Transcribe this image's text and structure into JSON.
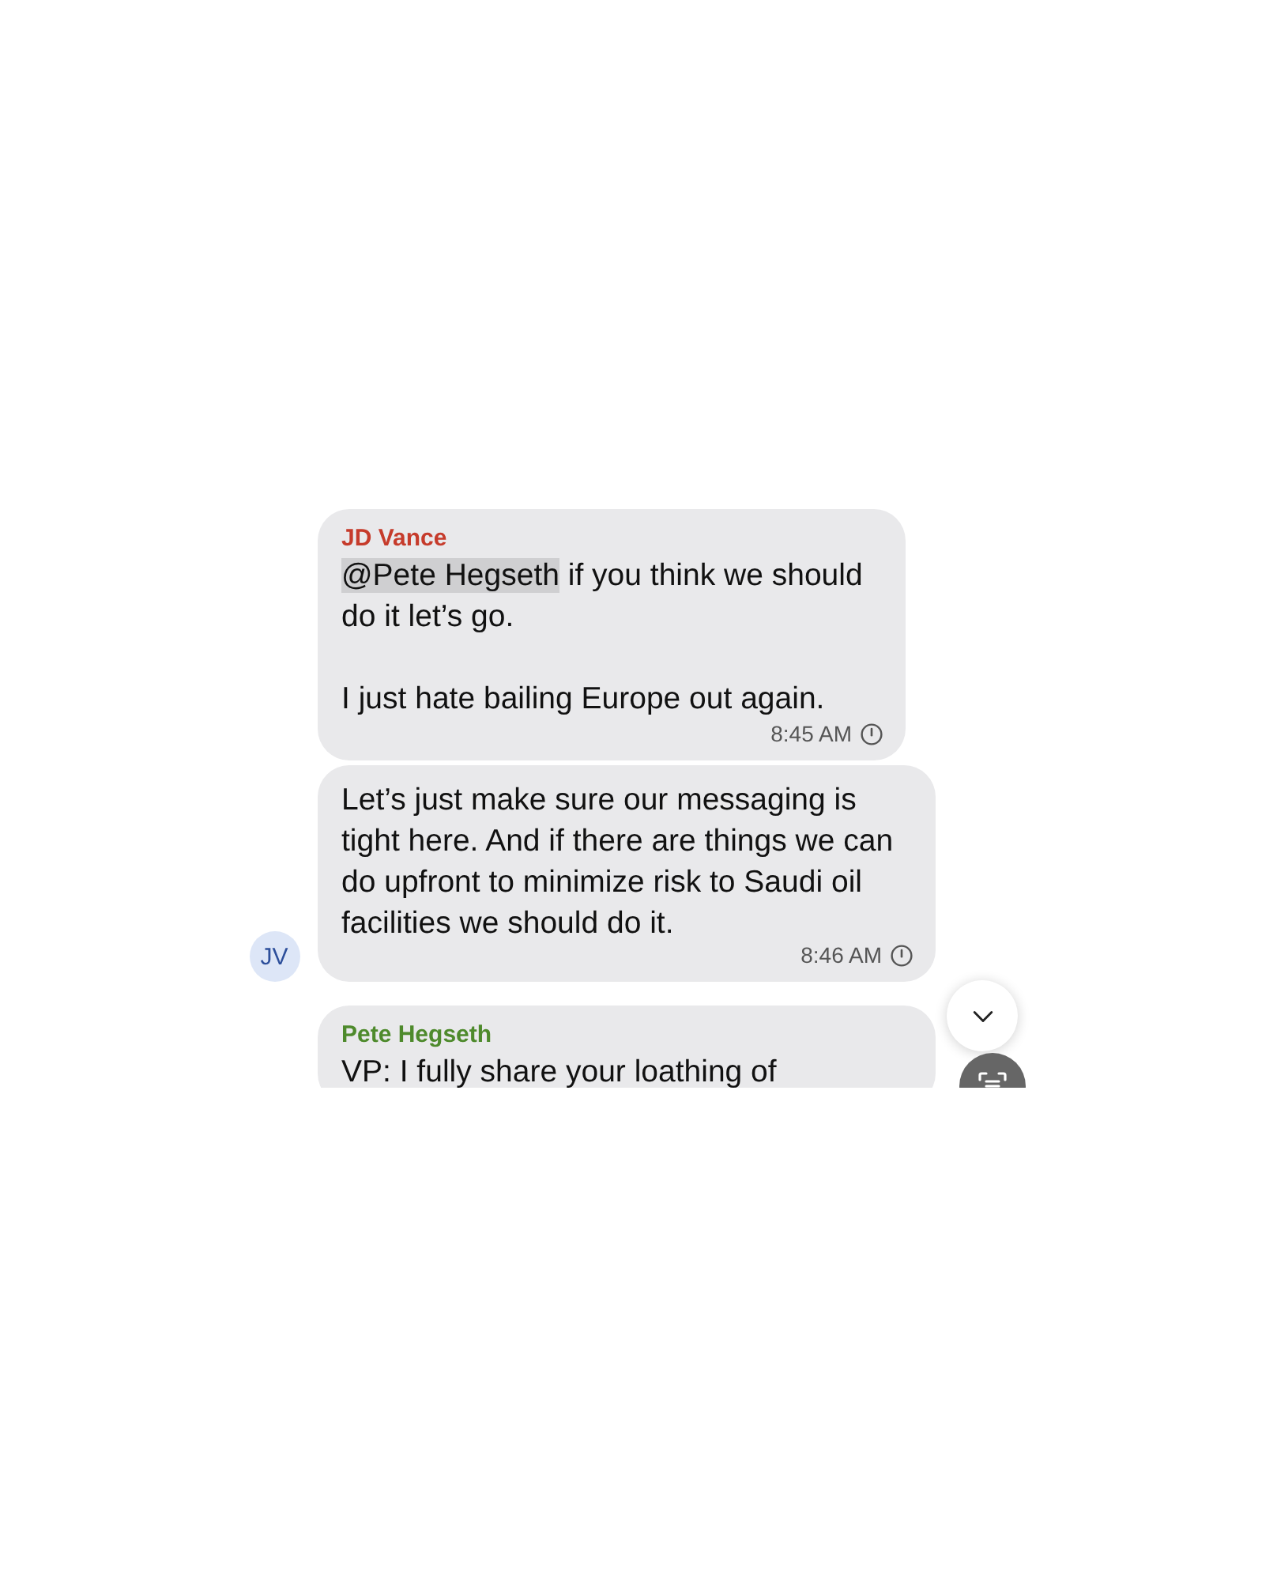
{
  "messages": [
    {
      "sender": "JD Vance",
      "color": "#c63b2b",
      "paragraphs": [
        {
          "mention": "@Pete Hegseth",
          "text": " if you think we should do it let’s go."
        },
        {
          "text": "I just hate bailing Europe out again."
        }
      ],
      "time": "8:45 AM"
    },
    {
      "paragraphs": [
        {
          "text": "Let’s just make sure our messaging is tight here. And if there are things we can do upfront to minimize risk to Saudi oil facilities we should do it."
        }
      ],
      "time": "8:46 AM",
      "avatar": "JV"
    },
    {
      "sender": "Pete Hegseth",
      "color": "#4e8a2c",
      "paragraphs": [
        {
          "text": "VP: I fully share your loathing of"
        }
      ]
    }
  ]
}
